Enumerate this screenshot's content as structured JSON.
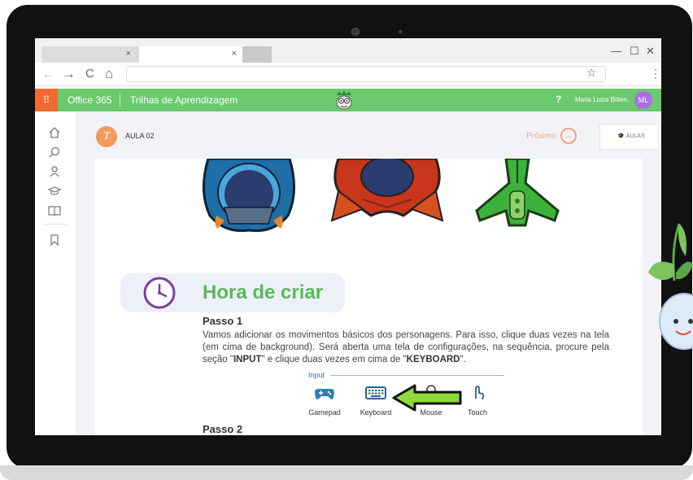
{
  "browser": {
    "tabs": [
      {
        "close": "×"
      },
      {
        "close": "×"
      },
      {
        "close": ""
      }
    ],
    "window_controls": {
      "minimize": "—",
      "maximize": "☐",
      "close": "✕"
    },
    "nav": {
      "back": "←",
      "forward": "→",
      "reload": "C",
      "home": "⌂"
    },
    "star": "☆",
    "menu": "⋮"
  },
  "o365": {
    "grid_icon": "⠿",
    "brand": "Office 365",
    "app_name": "Trilhas de Aprendizagem",
    "help": "?",
    "user_name": "Maria Luiza Bitten.",
    "avatar_initials": "ML",
    "accent_color": "#6bc96e"
  },
  "leftnav": {
    "icons": [
      "home-icon",
      "search-icon",
      "user-icon",
      "graduation-cap-icon",
      "book-icon",
      "bookmark-icon"
    ],
    "glyphs": [
      "⌂",
      "⚲",
      "♙",
      "🎓",
      "📖",
      "🔖"
    ]
  },
  "lesson": {
    "badge_letter": "T",
    "title": "AULA 02",
    "next_label": "Próximo",
    "next_arrow": "→",
    "aulas_label": "AULAS"
  },
  "body": {
    "section_title": "Hora de criar",
    "step1_title": "Passo 1",
    "step1_text_a": "Vamos adicionar os movimentos básicos dos personagens. Para isso, clique duas vezes na tela (em cima de background). Será aberta uma tela de configurações, na sequência, procure pela seção \"",
    "step1_bold_input": "INPUT",
    "step1_text_b": "\" e clique duas vezes em cima de \"",
    "step1_bold_keyboard": "KEYBOARD",
    "step1_text_c": "\".",
    "input_group_label": "Input",
    "devices": [
      "Gamepad",
      "Keyboard",
      "Mouse",
      "Touch"
    ],
    "step2_title": "Passo 2"
  }
}
